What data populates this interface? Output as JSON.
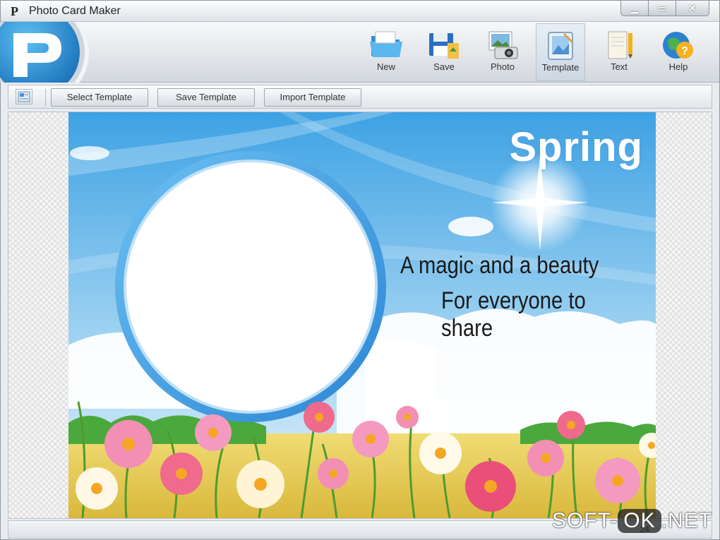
{
  "window": {
    "title": "Photo Card Maker",
    "title_icon_glyph": "P"
  },
  "toolbar": {
    "buttons": [
      {
        "label": "New",
        "icon": "folder-icon"
      },
      {
        "label": "Save",
        "icon": "save-icon"
      },
      {
        "label": "Photo",
        "icon": "camera-icon"
      },
      {
        "label": "Template",
        "icon": "template-icon",
        "active": true
      },
      {
        "label": "Text",
        "icon": "text-icon"
      },
      {
        "label": "Help",
        "icon": "help-icon"
      }
    ]
  },
  "template_bar": {
    "select_label": "Select Template",
    "save_label": "Save Template",
    "import_label": "Import Template"
  },
  "card": {
    "title": "Spring",
    "line1": "A magic and a beauty",
    "line2": "For everyone to share"
  },
  "statusbar": {
    "text": "24"
  },
  "watermark": {
    "left": "SOFT-",
    "ok": "OK",
    "right": ".NET"
  },
  "colors": {
    "sky_top": "#4aa8e6",
    "sky_bottom": "#cfe9f8",
    "frame_ring": "#3f9be0",
    "field": "#e8c94a"
  }
}
